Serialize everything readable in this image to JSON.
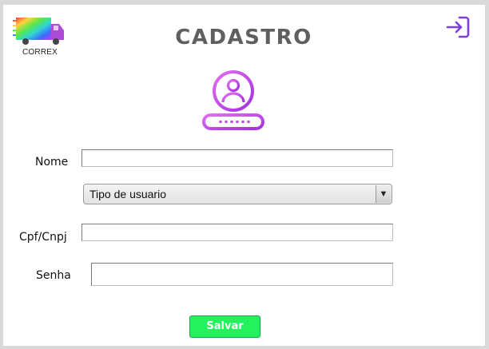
{
  "app": {
    "logo_text": "CORREX",
    "title": "CADASTRO"
  },
  "icons": {
    "logo": "truck-icon",
    "exit": "exit-icon",
    "user": "user-password-icon"
  },
  "form": {
    "nome_label": "Nome",
    "nome_value": "",
    "tipo_usuario_selected": "Tipo de usuario",
    "cpf_label": "Cpf/Cnpj",
    "cpf_value": "",
    "senha_label": "Senha",
    "senha_value": "",
    "save_label": "Salvar"
  },
  "colors": {
    "title": "#5f5f5f",
    "accent_purple": "#c04de6",
    "exit_icon": "#7b3fe0",
    "save_button": "#22f25c"
  }
}
